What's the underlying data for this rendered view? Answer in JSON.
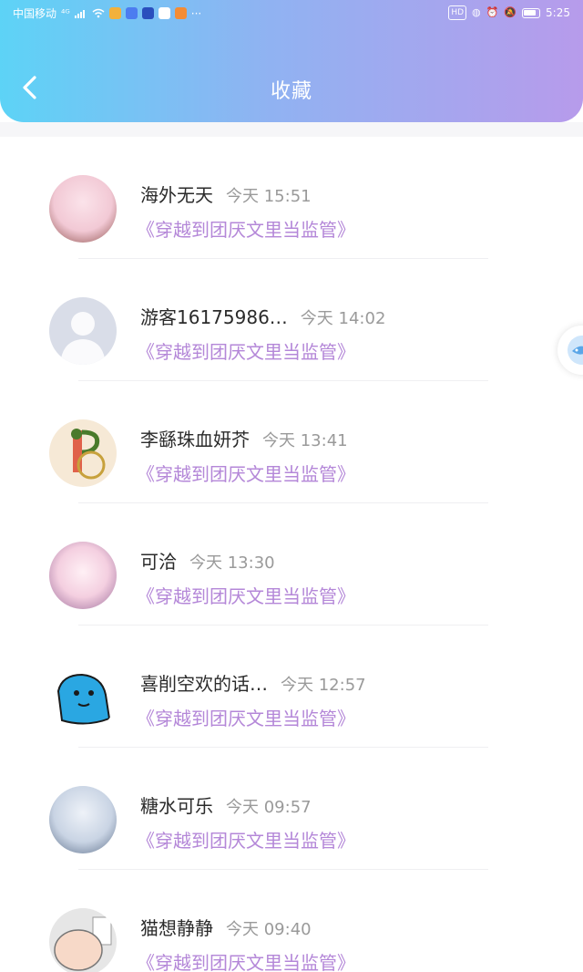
{
  "status": {
    "carrier": "中国移动",
    "net": "⁴ᴳ",
    "hd": "HD",
    "time": "5:25",
    "more": "···"
  },
  "header": {
    "title": "收藏",
    "back_icon": "chevron-left-icon"
  },
  "favorites": [
    {
      "name": "海外无天",
      "time": "今天 15:51",
      "book": "《穿越到团厌文里当监管》",
      "avatar_color": "#f2c9d5"
    },
    {
      "name": "游客16175986…",
      "time": "今天 14:02",
      "book": "《穿越到团厌文里当监管》",
      "avatar_color": "#d9dde8"
    },
    {
      "name": "李繇珠血妍芥",
      "time": "今天 13:41",
      "book": "《穿越到团厌文里当监管》",
      "avatar_color": "#f6e9d6"
    },
    {
      "name": "可洽",
      "time": "今天 13:30",
      "book": "《穿越到团厌文里当监管》",
      "avatar_color": "#f4cfe0"
    },
    {
      "name": "喜削空欢的话…",
      "time": "今天 12:57",
      "book": "《穿越到团厌文里当监管》",
      "avatar_color": "#2aa7e2"
    },
    {
      "name": "糖水可乐",
      "time": "今天 09:57",
      "book": "《穿越到团厌文里当监管》",
      "avatar_color": "#c9d4e4"
    },
    {
      "name": "猫想静静",
      "time": "今天 09:40",
      "book": "《穿越到团厌文里当监管》",
      "avatar_color": "#e6e6e6"
    }
  ],
  "colors": {
    "header_start": "#5dd3f6",
    "header_end": "#b79beb",
    "book_link": "#b487d8",
    "time_text": "#9a9a9a"
  }
}
